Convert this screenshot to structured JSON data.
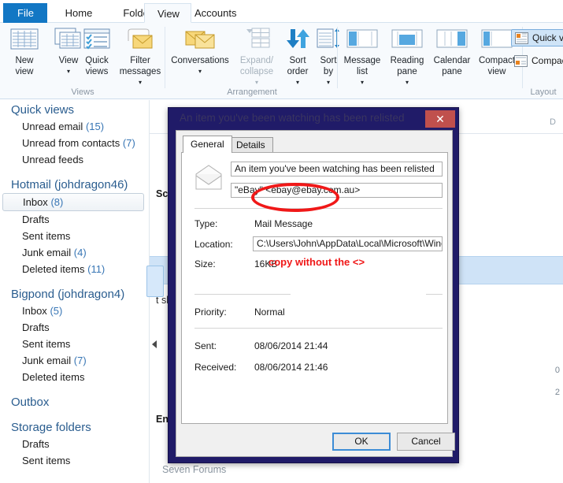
{
  "ribbon": {
    "tabs": [
      {
        "label": "File",
        "type": "file"
      },
      {
        "label": "Home",
        "type": "normal"
      },
      {
        "label": "Folders",
        "type": "normal"
      },
      {
        "label": "View",
        "type": "active"
      },
      {
        "label": "Accounts",
        "type": "normal"
      }
    ],
    "groups": [
      {
        "label": "Views"
      },
      {
        "label": "Arrangement"
      },
      {
        "label": "Layout"
      }
    ],
    "items": {
      "new_view": "New\nview",
      "new_view_l1": "New",
      "new_view_l2": "view",
      "view_l1": "View",
      "quick_views_l1": "Quick",
      "quick_views_l2": "views",
      "filter_l1": "Filter",
      "filter_l2": "messages",
      "conversations": "Conversations",
      "expand_l1": "Expand/",
      "expand_l2": "collapse",
      "sort_order_l1": "Sort",
      "sort_order_l2": "order",
      "sort_by_l1": "Sort",
      "sort_by_l2": "by",
      "message_list_l1": "Message",
      "message_list_l2": "list",
      "reading_pane_l1": "Reading",
      "reading_pane_l2": "pane",
      "calendar_pane_l1": "Calendar",
      "calendar_pane_l2": "pane",
      "compact_view_l1": "Compact",
      "compact_view_l2": "view",
      "quick_view_layout": "Quick view",
      "compact_layout": "Compact"
    }
  },
  "sidebar": {
    "sections": [
      {
        "header": "Quick views",
        "items": [
          {
            "label": "Unread email",
            "count": "(15)",
            "selected": false
          },
          {
            "label": "Unread from contacts",
            "count": "(7)",
            "selected": false
          },
          {
            "label": "Unread feeds",
            "count": "",
            "selected": false
          }
        ]
      },
      {
        "header": "Hotmail (johdragon46)",
        "items": [
          {
            "label": "Inbox",
            "count": "(8)",
            "selected": true
          },
          {
            "label": "Drafts",
            "count": "",
            "selected": false
          },
          {
            "label": "Sent items",
            "count": "",
            "selected": false
          },
          {
            "label": "Junk email",
            "count": "(4)",
            "selected": false
          },
          {
            "label": "Deleted items",
            "count": "(11)",
            "selected": false
          }
        ]
      },
      {
        "header": "Bigpond (johdragon4)",
        "items": [
          {
            "label": "Inbox",
            "count": "(5)",
            "selected": false
          },
          {
            "label": "Drafts",
            "count": "",
            "selected": false
          },
          {
            "label": "Sent items",
            "count": "",
            "selected": false
          },
          {
            "label": "Junk email",
            "count": "(7)",
            "selected": false
          },
          {
            "label": "Deleted items",
            "count": "",
            "selected": false
          }
        ]
      },
      {
        "header": "Outbox",
        "items": []
      },
      {
        "header": "Storage folders",
        "items": [
          {
            "label": "Drafts",
            "count": "",
            "selected": false
          },
          {
            "label": "Sent items",
            "count": "",
            "selected": false
          }
        ]
      }
    ]
  },
  "maillist": {
    "column_header": "D",
    "rows": [
      {
        "subject": "Screen'",
        "bold": true,
        "selected": false
      },
      {
        "subject": "",
        "bold": false,
        "selected": true
      },
      {
        "subject": "t shut down prop...",
        "bold": false,
        "selected": false
      },
      {
        "subject": "Enable or Disable'",
        "bold": true,
        "selected": false
      }
    ],
    "meta": [
      "0",
      "2"
    ],
    "footer": "Seven Forums"
  },
  "dialog": {
    "title": "An item you've been watching has been relisted",
    "close_label": "✕",
    "tabs": [
      {
        "label": "General",
        "active": true
      },
      {
        "label": "Details",
        "active": false
      }
    ],
    "subject_field": "An item you've been watching has been relisted",
    "from_field": "\"eBay\" <ebay@ebay.com.au>",
    "fields": [
      {
        "label": "Type:",
        "value": "Mail Message",
        "boxed": false
      },
      {
        "label": "Location:",
        "value": "C:\\Users\\John\\AppData\\Local\\Microsoft\\Window",
        "boxed": true
      },
      {
        "label": "Size:",
        "value": "16KB",
        "boxed": false
      },
      {
        "label": "Priority:",
        "value": "Normal",
        "boxed": false
      },
      {
        "label": "Sent:",
        "value": "08/06/2014 21:44",
        "boxed": false
      },
      {
        "label": "Received:",
        "value": "08/06/2014 21:46",
        "boxed": false
      }
    ],
    "buttons": [
      {
        "label": "OK",
        "default": true
      },
      {
        "label": "Cancel",
        "default": false
      }
    ]
  },
  "annotations": {
    "note_text": "copy without the <>",
    "color": "#f01818"
  },
  "colors": {
    "file_tab": "#1277c4",
    "dialog_titlebar": "#201b68",
    "close_button": "#c0504d",
    "sidebar_header": "#2a5d8f",
    "count_text": "#3876b5",
    "selection": "#cfe3f7",
    "annotation_red": "#f01818"
  }
}
